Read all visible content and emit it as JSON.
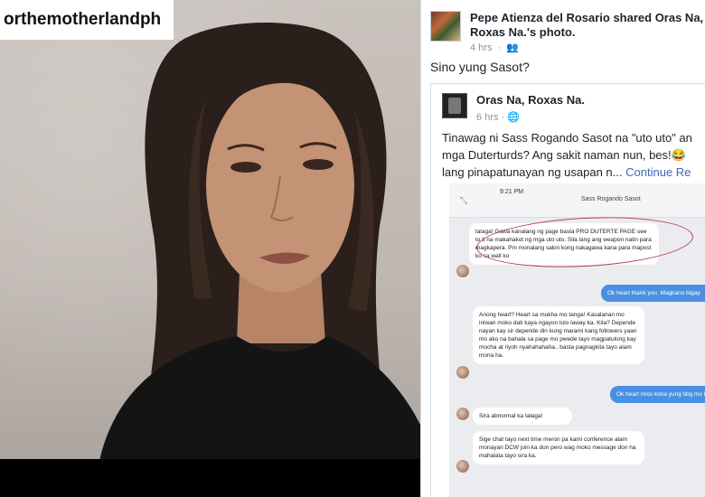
{
  "video": {
    "handle": "orthemotherlandph"
  },
  "post": {
    "sharer_line": "Pepe Atienza del Rosario shared Oras Na, Roxas Na.'s photo.",
    "time": "4 hrs",
    "caption": "Sino yung Sasot?"
  },
  "shared": {
    "page_name": "Oras Na, Roxas Na.",
    "time": "6 hrs",
    "text_line1": "Tinawag ni Sass Rogando Sasot na \"uto uto\" an",
    "text_line2": "mga Duterturds? Ang sakit naman nun, bes!😂",
    "text_line3": "lang pinapatunayan ng usapan n...",
    "continue": "Continue Re"
  },
  "chat": {
    "status_time": "9:21 PM",
    "contact": "Sass Rogando Sasot",
    "messages": [
      {
        "dir": "in",
        "text": "talaga! Gawa kanalang ng page basta PRO DUTERTE PAGE see to it na makahakot ng mga uto uto. Sila lang ang weapon natin para magkapera. Pm monalang sakin kong nakagawa kana para mapost ko sa wall ko"
      },
      {
        "dir": "out",
        "text": "Ok heart thank you. Magkano bigay"
      },
      {
        "dir": "in",
        "text": "Anong heart? Heart sa mukha mo tanga! Kasalanan mo iniwan moko dati kaya ngayon tulo laway ka. Kita? Depende nayan kay sir depende din kung marami kang followers yaan mo ako na bahala sa page mo pwede tayo magpatulong kay mocha at riyoh nyahahahaha.. basta pagnagkita tayo alam mona ha."
      },
      {
        "dir": "out",
        "text": "Ok heart miss kona yung tibg mo h"
      },
      {
        "dir": "in",
        "text": "Sira abnormal ka talaga!"
      },
      {
        "dir": "in",
        "text": "Sige chat tayo next time meron pa kami conference alam monayan DCW join ka don pero wag moko message don ha mahalata tayo sira ka."
      }
    ]
  },
  "colors": {
    "link": "#4267b2",
    "outgoing_bubble": "#4a90e2",
    "annotation_circle": "#b63d5a"
  }
}
